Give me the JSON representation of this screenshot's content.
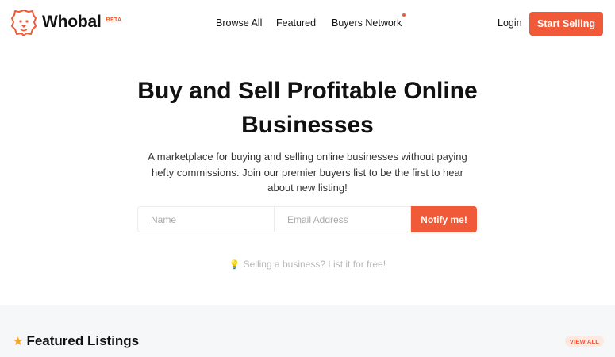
{
  "brand": {
    "name": "Whobal",
    "badge": "BETA",
    "accent_color": "#f05a38"
  },
  "nav": {
    "items": [
      {
        "label": "Browse All"
      },
      {
        "label": "Featured"
      },
      {
        "label": "Buyers Network",
        "has_notification_dot": true
      }
    ],
    "login_label": "Login",
    "cta_label": "Start Selling"
  },
  "hero": {
    "title_line1": "Buy and Sell Profitable Online",
    "title_line2": "Businesses",
    "subtitle_line1": "A marketplace for buying and selling online businesses without paying",
    "subtitle_line2": "hefty commissions. Join our premier buyers list to be the first to hear",
    "subtitle_line3": "about new listing!"
  },
  "signup_form": {
    "name_placeholder": "Name",
    "email_placeholder": "Email Address",
    "submit_label": "Notify me!"
  },
  "sell_prompt": {
    "icon": "lightbulb-icon",
    "text": "Selling a business? List it for free!"
  },
  "featured": {
    "icon": "star-icon",
    "title": "Featured Listings",
    "view_all_label": "VIEW ALL"
  }
}
